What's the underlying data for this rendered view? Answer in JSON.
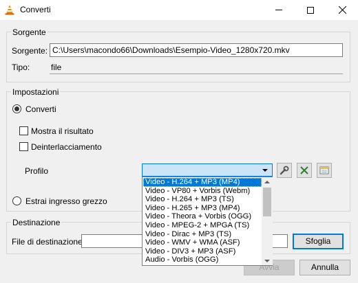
{
  "window": {
    "title": "Converti",
    "icon": "vlc-cone-icon"
  },
  "source_group": {
    "label": "Sorgente",
    "source_label": "Sorgente:",
    "source_value": "C:\\Users\\macondo66\\Downloads\\Esempio-Video_1280x720.mkv",
    "type_label": "Tipo:",
    "type_value": "file"
  },
  "settings_group": {
    "label": "Impostazioni",
    "convert_radio": {
      "label": "Converti",
      "checked": true
    },
    "show_output": {
      "label": "Mostra il risultato",
      "checked": false
    },
    "deinterlace": {
      "label": "Deinterlacciamento",
      "checked": false
    },
    "profile_label": "Profilo",
    "profile_selected": "Video - H.264 + MP3 (MP4)",
    "profile_buttons": [
      "wrench-icon",
      "delete-x-icon",
      "new-profile-icon"
    ],
    "raw_input_radio": {
      "label": "Estrai ingresso grezzo",
      "checked": false
    }
  },
  "profile_options": [
    "Video - H.264 + MP3 (MP4)",
    "Video - VP80 + Vorbis (Webm)",
    "Video - H.264 + MP3 (TS)",
    "Video - H.265 + MP3 (MP4)",
    "Video - Theora + Vorbis (OGG)",
    "Video - MPEG-2 + MPGA (TS)",
    "Video - Dirac + MP3 (TS)",
    "Video - WMV + WMA (ASF)",
    "Video - DIV3 + MP3 (ASF)",
    "Audio - Vorbis (OGG)"
  ],
  "destination_group": {
    "label": "Destinazione",
    "file_label": "File di destinazione:",
    "file_value": "",
    "browse_button": "Sfoglia"
  },
  "footer": {
    "start_button": "Avvia",
    "cancel_button": "Annulla"
  },
  "colors": {
    "accent": "#0078d7",
    "combo_bg": "#cce4f7",
    "window_bg": "#f0f0f0"
  }
}
